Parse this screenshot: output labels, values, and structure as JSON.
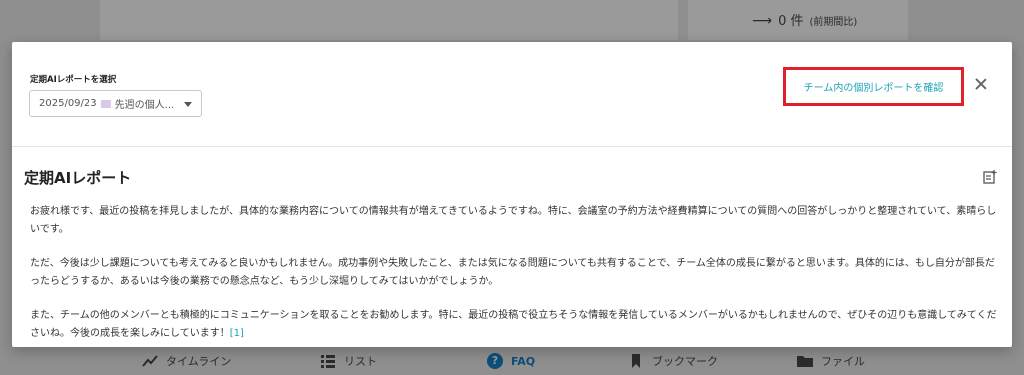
{
  "background": {
    "stat": {
      "count": "0 件",
      "compare": "(前期間比)"
    },
    "nav": [
      {
        "label": "タイムライン",
        "icon": "trend-icon"
      },
      {
        "label": "リスト",
        "icon": "list-icon"
      },
      {
        "label": "FAQ",
        "icon": "help-icon"
      },
      {
        "label": "ブックマーク",
        "icon": "bookmark-icon"
      },
      {
        "label": "ファイル",
        "icon": "folder-icon"
      }
    ]
  },
  "modal": {
    "select_label": "定期AIレポートを選択",
    "select_value_date": "2025/09/23",
    "select_value_text": "先週の個人...",
    "team_link": "チーム内の個別レポートを確認",
    "close_icon": "close-icon",
    "report_title": "定期AIレポート",
    "export_icon": "export-icon",
    "paragraphs": [
      "お疲れ様です、最近の投稿を拝見しましたが、具体的な業務内容についての情報共有が増えてきているようですね。特に、会議室の予約方法や経費精算についての質問への回答がしっかりと整理されていて、素晴らしいです。",
      "ただ、今後は少し課題についても考えてみると良いかもしれません。成功事例や失敗したこと、または気になる問題についても共有することで、チーム全体の成長に繋がると思います。具体的には、もし自分が部長だったらどうするか、あるいは今後の業務での懸念点など、もう少し深堀りしてみてはいかがでしょうか。",
      "また、チームの他のメンバーとも積極的にコミュニケーションを取ることをお勧めします。特に、最近の投稿で役立ちそうな情報を発信しているメンバーがいるかもしれませんので、ぜひその辺りも意識してみてくださいね。今後の成長を楽しみにしています！"
    ],
    "ref": "[1]"
  }
}
